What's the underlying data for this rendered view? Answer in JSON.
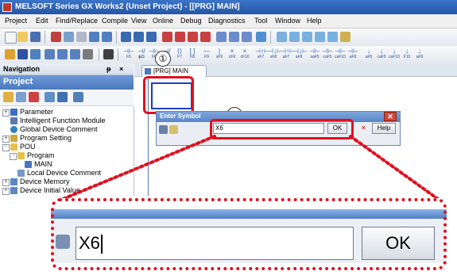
{
  "window": {
    "title": "MELSOFT Series GX Works2 (Unset Project) - [[PRG] MAIN]"
  },
  "menu": [
    "Project",
    "Edit",
    "Find/Replace",
    "Compile",
    "View",
    "Online",
    "Debug",
    "Diagnostics",
    "Tool",
    "Window",
    "Help"
  ],
  "navigation": {
    "header": "Navigation",
    "pin": "&#x2021; x",
    "project_label": "Project",
    "tree": [
      {
        "label": "Parameter",
        "level": 0,
        "expander": "+"
      },
      {
        "label": "Intelligent Function Module",
        "level": 0,
        "expander": ""
      },
      {
        "label": "Global Device Comment",
        "level": 0,
        "expander": ""
      },
      {
        "label": "Program Setting",
        "level": 0,
        "expander": "+"
      },
      {
        "label": "POU",
        "level": 0,
        "expander": "-"
      },
      {
        "label": "Program",
        "level": 1,
        "expander": "-"
      },
      {
        "label": "MAIN",
        "level": 2,
        "expander": ""
      },
      {
        "label": "Local Device Comment",
        "level": 1,
        "expander": ""
      },
      {
        "label": "Device Memory",
        "level": 0,
        "expander": "+"
      },
      {
        "label": "Device Initial Value",
        "level": 0,
        "expander": "+"
      }
    ]
  },
  "editor": {
    "tab_label": "[PRG] MAIN"
  },
  "dialog": {
    "title": "Enter Symbol",
    "input_value": "X6",
    "ok_label": "OK",
    "help_label": "Help",
    "x_glyph": "✕"
  },
  "zoom": {
    "input_value": "X6",
    "ok_label": "OK"
  },
  "callouts": {
    "one": "①",
    "two": "②"
  },
  "colors": {
    "highlight": "#e0101e",
    "title_bar": "#2457a8"
  }
}
